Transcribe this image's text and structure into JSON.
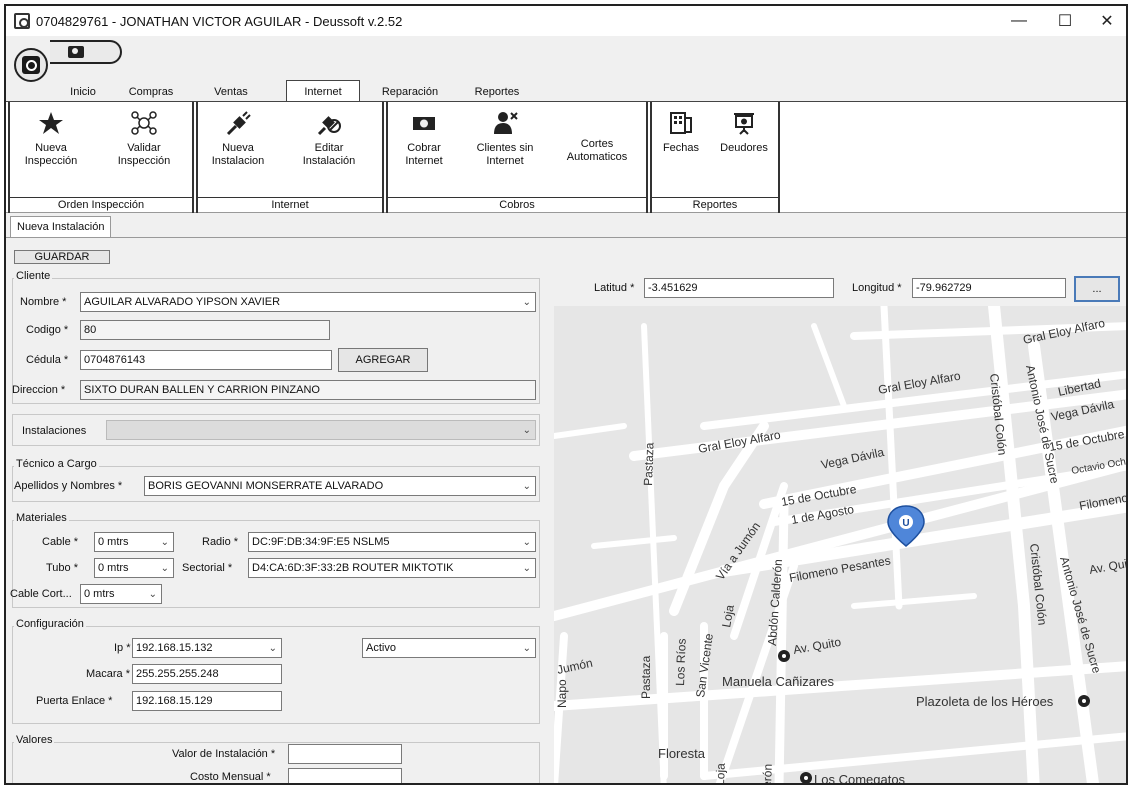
{
  "window": {
    "title": "0704829761 - JONATHAN VICTOR AGUILAR -  Deussoft v.2.52",
    "minimize": "—",
    "maximize": "☐",
    "close": "✕"
  },
  "tabs": [
    "Inicio",
    "Compras",
    "Ventas",
    "Internet",
    "Reparación",
    "Reportes"
  ],
  "active_tab": "Internet",
  "ribbon": {
    "groups": [
      {
        "label": "Orden Inspección",
        "buttons": [
          {
            "line1": "Nueva",
            "line2": "Inspección",
            "icon": "star-tool-icon"
          },
          {
            "line1": "Validar",
            "line2": "Inspección",
            "icon": "network-icon"
          }
        ]
      },
      {
        "label": "Internet",
        "buttons": [
          {
            "line1": "Nueva",
            "line2": "Instalacion",
            "icon": "cable-plug-icon"
          },
          {
            "line1": "Editar",
            "line2": "Instalación",
            "icon": "cable-edit-icon"
          }
        ]
      },
      {
        "label": "Cobros",
        "buttons": [
          {
            "line1": "Cobrar",
            "line2": "Internet",
            "icon": "money-icon"
          },
          {
            "line1": "Clientes sin",
            "line2": "Internet",
            "icon": "user-x-icon"
          },
          {
            "line1": "Cortes",
            "line2": "Automaticos",
            "icon": ""
          }
        ]
      },
      {
        "label": "Reportes",
        "buttons": [
          {
            "line1": "Fechas",
            "line2": "",
            "icon": "calendar-icon"
          },
          {
            "line1": "Deudores",
            "line2": "",
            "icon": "presentation-icon"
          }
        ]
      }
    ]
  },
  "doc_tab": "Nueva Instalación",
  "guardar": "GUARDAR",
  "cliente": {
    "legend": "Cliente",
    "nombre_label": "Nombre *",
    "nombre": "AGUILAR ALVARADO YIPSON XAVIER",
    "codigo_label": "Codigo *",
    "codigo": "80",
    "cedula_label": "Cédula *",
    "cedula": "0704876143",
    "agregar": "AGREGAR",
    "direccion_label": "Direccion *",
    "direccion": "SIXTO DURAN BALLEN Y CARRION PINZANO"
  },
  "instalaciones_label": "Instalaciones",
  "tecnico": {
    "legend": "Técnico a Cargo",
    "label": "Apellidos y Nombres *",
    "value": "BORIS GEOVANNI MONSERRATE ALVARADO"
  },
  "materiales": {
    "legend": "Materiales",
    "cable_label": "Cable *",
    "cable": "0 mtrs",
    "tubo_label": "Tubo *",
    "tubo": "0 mtrs",
    "cable_cort_label": "Cable Cort...",
    "cable_cort": "0 mtrs",
    "radio_label": "Radio *",
    "radio": "DC:9F:DB:34:9F:E5  NSLM5",
    "sectorial_label": "Sectorial *",
    "sectorial": "D4:CA:6D:3F:33:2B ROUTER MIKTOTIK"
  },
  "configuracion": {
    "legend": "Configuración",
    "ip_label": "Ip *",
    "ip": "192.168.15.132",
    "estado": "Activo",
    "macara_label": "Macara *",
    "macara": "255.255.255.248",
    "puerta_label": "Puerta Enlace *",
    "puerta": "192.168.15.129"
  },
  "valores": {
    "legend": "Valores",
    "instalacion_label": "Valor de Instalación *",
    "instalacion": "",
    "mensual_label": "Costo Mensual *",
    "mensual": ""
  },
  "coords": {
    "lat_label": "Latitud *",
    "lat": "-3.451629",
    "lon_label": "Longitud *",
    "lon": "-79.962729",
    "more": "..."
  },
  "map": {
    "marker_letter": "U",
    "labels": [
      "Gral Eloy Alfaro",
      "Gral Eloy Alfaro",
      "Gral Eloy Alfaro",
      "Libertad",
      "Vega Dávila",
      "Vega Dávila",
      "15 de Octubre",
      "15 de Octubre",
      "1 de Agosto",
      "Octavio Och",
      "Filomeno",
      "Filomeno Pesantes",
      "Av. Quito",
      "Av. Quit",
      "Vía a Jumón",
      "Jumón",
      "Pastaza",
      "Pastaza",
      "Los Ríos",
      "San Vicente",
      "Loja",
      "Loja",
      "Abdón Calderón",
      "erón",
      "Napo",
      "Cristóbal Colón",
      "Cristóbal Colón",
      "Antonio José de Sucre",
      "Antonio José de Sucre",
      "Manuela Cañizares",
      "Plazoleta de los Héroes",
      "Floresta",
      "Los Comegatos"
    ]
  }
}
